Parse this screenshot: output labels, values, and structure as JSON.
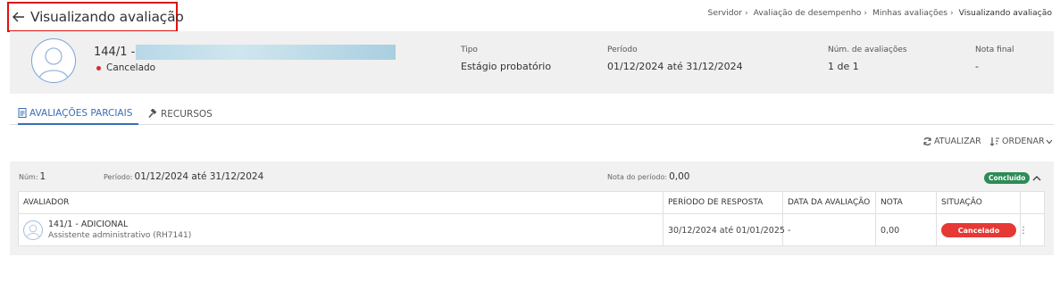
{
  "header": {
    "title": "Visualizando avaliação",
    "back_icon": "arrow-left-icon"
  },
  "breadcrumb": [
    "Servidor",
    "Avaliação de desempenho",
    "Minhas avaliações",
    "Visualizando avaliação"
  ],
  "summary": {
    "employee_id": "144/1 -",
    "status": "Cancelado",
    "status_color": "#d32f2f",
    "tipo_label": "Tipo",
    "tipo_value": "Estágio probatório",
    "periodo_label": "Período",
    "periodo_value": "01/12/2024 até 31/12/2024",
    "num_label": "Núm. de avaliações",
    "num_value": "1 de 1",
    "nota_label": "Nota final",
    "nota_value": "-"
  },
  "tabs": [
    {
      "label": "AVALIAÇÕES PARCIAIS",
      "icon": "document-icon",
      "active": true
    },
    {
      "label": "RECURSOS",
      "icon": "gavel-icon",
      "active": false
    }
  ],
  "toolbar": {
    "refresh_label": "ATUALIZAR",
    "sort_label": "ORDENAR"
  },
  "evaluation": {
    "num_label": "Núm:",
    "num_value": "1",
    "periodo_label": "Período:",
    "periodo_value": "01/12/2024 até 31/12/2024",
    "nota_label": "Nota do período:",
    "nota_value": "0,00",
    "badge": "Concluído",
    "badge_color": "#2e8b57",
    "table": {
      "columns": [
        "AVALIADOR",
        "PERÍODO DE RESPOSTA",
        "DATA DA AVALIAÇÃO",
        "NOTA",
        "SITUAÇÃO"
      ],
      "rows": [
        {
          "evaluator_name": "141/1 - ADICIONAL",
          "evaluator_role": "Assistente administrativo (RH7141)",
          "periodo_resposta": "30/12/2024 até 01/01/2025",
          "data_avaliacao": "-",
          "nota": "0,00",
          "situacao": "Cancelado",
          "situacao_color": "#e53935"
        }
      ]
    }
  },
  "colors": {
    "accent": "#3a6fb5",
    "highlight_border": "#e01010"
  }
}
